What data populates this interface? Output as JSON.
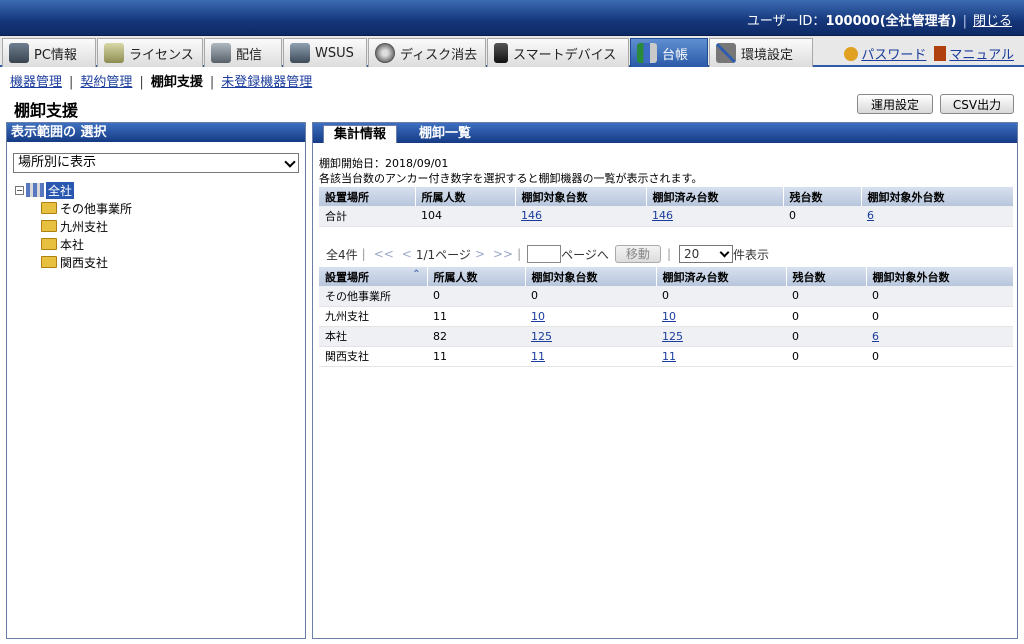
{
  "header": {
    "user_label": "ユーザーID：",
    "user_value": "100000(全社管理者)",
    "logout": "閉じる"
  },
  "tabs": [
    {
      "label": "PC情報",
      "icon": "pc-icon"
    },
    {
      "label": "ライセンス",
      "icon": "license-icon"
    },
    {
      "label": "配信",
      "icon": "distribution-icon"
    },
    {
      "label": "WSUS",
      "icon": "wsus-icon"
    },
    {
      "label": "ディスク消去",
      "icon": "disk-erase-icon"
    },
    {
      "label": "スマートデバイス",
      "icon": "smartphone-icon"
    },
    {
      "label": "台帳",
      "icon": "ledger-icon"
    },
    {
      "label": "環境設定",
      "icon": "settings-tools-icon"
    }
  ],
  "right_links": {
    "password": "パスワード",
    "manual": "マニュアル"
  },
  "subnav": {
    "items": [
      "機器管理",
      "契約管理",
      "棚卸支援",
      "未登録機器管理"
    ],
    "current": "棚卸支援"
  },
  "page": {
    "title": "棚卸支援",
    "btn_settings": "運用設定",
    "btn_csv": "CSV出力"
  },
  "left": {
    "header": "表示範囲の 選択",
    "select_value": "場所別に表示",
    "tree_root": "全社",
    "tree_children": [
      "その他事業所",
      "九州支社",
      "本社",
      "関西支社"
    ]
  },
  "right": {
    "tabs": [
      "集計情報",
      "棚卸一覧"
    ],
    "start_date": "棚卸開始日：2018/09/01",
    "hint": "各該当台数のアンカー付き数字を選択すると棚卸機器の一覧が表示されます。",
    "summary_headers": [
      "設置場所",
      "所属人数",
      "棚卸対象台数",
      "棚卸済み台数",
      "残台数",
      "棚卸対象外台数"
    ],
    "summary_row": [
      "合計",
      "104",
      "146",
      "146",
      "0",
      "6"
    ],
    "pager": {
      "count": "全4件",
      "first": "<<",
      "prev": "<",
      "page": "1/1ページ",
      "next": ">",
      "last": ">>",
      "goto_suffix": "ページへ",
      "move": "移動",
      "page_size": "20",
      "per_page": "件表示"
    },
    "list_headers": [
      "設置場所",
      "所属人数",
      "棚卸対象台数",
      "棚卸済み台数",
      "残台数",
      "棚卸対象外台数"
    ],
    "list_rows": [
      [
        "その他事業所",
        "0",
        "0",
        "0",
        "0",
        "0"
      ],
      [
        "九州支社",
        "11",
        "10",
        "10",
        "0",
        "0"
      ],
      [
        "本社",
        "82",
        "125",
        "125",
        "0",
        "6"
      ],
      [
        "関西支社",
        "11",
        "11",
        "11",
        "0",
        "0"
      ]
    ]
  }
}
